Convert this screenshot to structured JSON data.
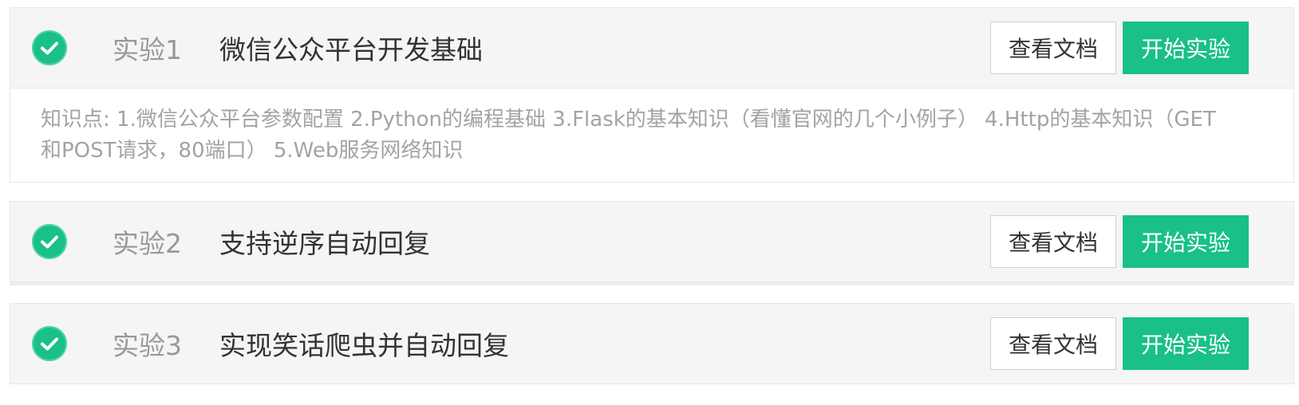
{
  "labs": [
    {
      "number": "实验1",
      "title": "微信公众平台开发基础",
      "doc_button": "查看文档",
      "start_button": "开始实验",
      "description": "知识点: 1.微信公众平台参数配置 2.Python的编程基础 3.Flask的基本知识（看懂官网的几个小例子） 4.Http的基本知识（GET和POST请求，80端口） 5.Web服务网络知识",
      "completed": true
    },
    {
      "number": "实验2",
      "title": "支持逆序自动回复",
      "doc_button": "查看文档",
      "start_button": "开始实验",
      "completed": true
    },
    {
      "number": "实验3",
      "title": "实现笑话爬虫并自动回复",
      "doc_button": "查看文档",
      "start_button": "开始实验",
      "completed": true
    }
  ],
  "icons": {
    "completed": "check-circle-icon"
  },
  "colors": {
    "accent": "#19c087",
    "header_bg": "#f5f5f5",
    "muted_text": "#999999",
    "title_text": "#333333"
  }
}
